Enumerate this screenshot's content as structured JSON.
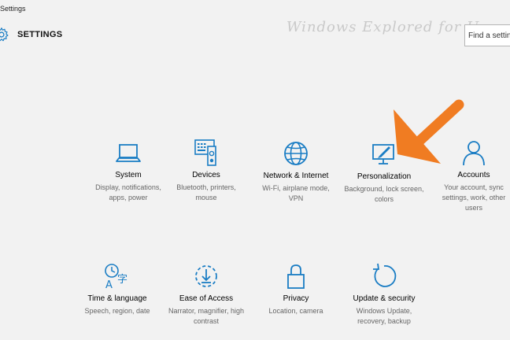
{
  "window": {
    "title": "Settings"
  },
  "header": {
    "title": "SETTINGS",
    "icon": "gear-icon"
  },
  "watermark": "Windows Explored for U",
  "search": {
    "placeholder": "Find a setting",
    "value": ""
  },
  "accent_color": "#1a7dc4",
  "arrow_color": "#f07c22",
  "tiles": [
    {
      "name": "System",
      "desc": "Display, notifications, apps, power",
      "icon": "laptop-icon"
    },
    {
      "name": "Devices",
      "desc": "Bluetooth, printers, mouse",
      "icon": "devices-icon"
    },
    {
      "name": "Network & Internet",
      "desc": "Wi-Fi, airplane mode, VPN",
      "icon": "globe-icon"
    },
    {
      "name": "Personalization",
      "desc": "Background, lock screen, colors",
      "icon": "personalization-icon"
    },
    {
      "name": "Accounts",
      "desc": "Your account, sync settings, work, other users",
      "icon": "person-icon"
    },
    {
      "name": "Time & language",
      "desc": "Speech, region, date",
      "icon": "time-language-icon"
    },
    {
      "name": "Ease of Access",
      "desc": "Narrator, magnifier, high contrast",
      "icon": "ease-of-access-icon"
    },
    {
      "name": "Privacy",
      "desc": "Location, camera",
      "icon": "lock-icon"
    },
    {
      "name": "Update & security",
      "desc": "Windows Update, recovery, backup",
      "icon": "update-icon"
    }
  ]
}
